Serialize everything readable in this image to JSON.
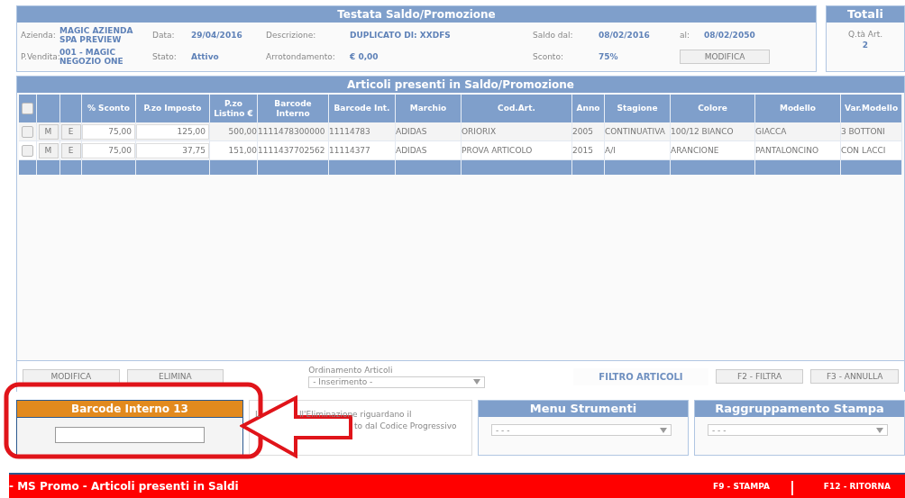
{
  "header": {
    "title": "Testata Saldo/Promozione",
    "fields": [
      {
        "label": "Azienda:",
        "value": "MAGIC AZIENDA SPA PREVIEW"
      },
      {
        "label": "Data:",
        "value": "29/04/2016"
      },
      {
        "label": "Descrizione:",
        "value": "DUPLICATO DI: XXDFS"
      },
      {
        "label": "Saldo dal:",
        "value": "08/02/2016"
      },
      {
        "label": "al:",
        "value": "08/02/2050"
      },
      {
        "label": "P.Vendita:",
        "value": "001 - MAGIC NEGOZIO ONE"
      },
      {
        "label": "Stato:",
        "value": "Attivo"
      },
      {
        "label": "Arrotondamento:",
        "value": "€ 0,00"
      },
      {
        "label": "Sconto:",
        "value": "75%"
      }
    ],
    "button": "MODIFICA"
  },
  "totals": {
    "title": "Totali",
    "label": "Q.tà Art.",
    "value": "2"
  },
  "articles": {
    "title": "Articoli presenti in Saldo/Promozione",
    "columns": [
      "% Sconto",
      "P.zo Imposto",
      "P.zo Listino €",
      "Barcode Interno",
      "Barcode Int.",
      "Marchio",
      "Cod.Art.",
      "Anno",
      "Stagione",
      "Colore",
      "Modello",
      "Var.Modello"
    ],
    "all_selected": false,
    "rows": [
      {
        "selected": false,
        "edit": "M",
        "delete": "E",
        "cells": [
          "75,00",
          "125,00",
          "500,00",
          "1111478300000",
          "11114783",
          "ADIDAS",
          "ORIORIX",
          "2005",
          "CONTINUATIVA",
          "100/12 BIANCO",
          "GIACCA",
          "3 BOTTONI"
        ]
      },
      {
        "selected": false,
        "edit": "M",
        "delete": "E",
        "cells": [
          "75,00",
          "37,75",
          "151,00",
          "1111437702562",
          "11114377",
          "ADIDAS",
          "PROVA ARTICOLO",
          "2015",
          "A/I",
          "ARANCIONE",
          "PANTALONCINO",
          "CON LACCI"
        ]
      }
    ]
  },
  "actions": {
    "buttons": [
      "MODIFICA",
      "ELIMINA"
    ],
    "sort_label": "Ordinamento Articoli",
    "sort_value": "- Inserimento -",
    "filter_title": "FILTRO ARTICOLI",
    "filter_buttons": [
      "F2 - FILTRA",
      "F3 - ANNULLA"
    ]
  },
  "barcode": {
    "title": "Barcode Interno 13"
  },
  "info": {
    "lead": "L",
    "line1": "ll'Eliminazione riguardano il",
    "line2": "to dal Codice Progressivo"
  },
  "menu_strumenti": {
    "title": "Menu Strumenti",
    "value": "- - -"
  },
  "raggruppamento": {
    "title": "Raggruppamento Stampa",
    "value": "- - -"
  },
  "footer": {
    "title": "- MS Promo - Articoli presenti in Saldi",
    "keys": [
      "F9 - STAMPA",
      "F12 - RITORNA"
    ],
    "separator": "|"
  }
}
